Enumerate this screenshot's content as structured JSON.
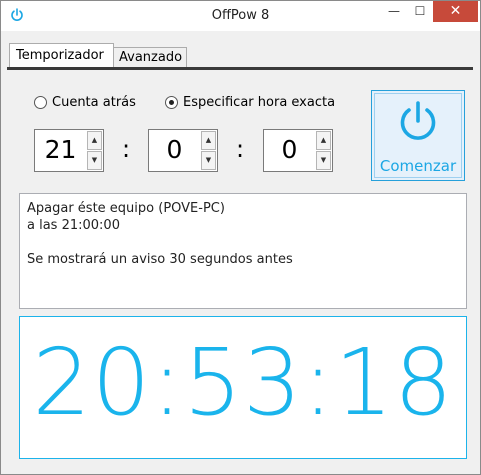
{
  "window": {
    "title": "OffPow 8",
    "min_glyph": "—",
    "max_glyph": "☐",
    "close_glyph": "✕",
    "app_icon": "power-icon"
  },
  "tabs": [
    {
      "label": "Temporizador",
      "active": true
    },
    {
      "label": "Avanzado",
      "active": false
    }
  ],
  "mode": {
    "options": [
      {
        "label": "Cuenta atrás",
        "selected": false
      },
      {
        "label": "Especificar hora exacta",
        "selected": true
      }
    ]
  },
  "time": {
    "hours": "21",
    "minutes": "0",
    "seconds": "0",
    "separator": ":"
  },
  "start_button": {
    "label": "Comenzar",
    "icon": "power-icon",
    "accent": "#1ca7e4"
  },
  "info": {
    "line1": "Apagar éste equipo (POVE-PC)",
    "line2": "a las 21:00:00",
    "line3": "Se mostrará un aviso 30 segundos antes"
  },
  "clock": {
    "value": "20:53:18",
    "color": "#1ab4ec"
  }
}
